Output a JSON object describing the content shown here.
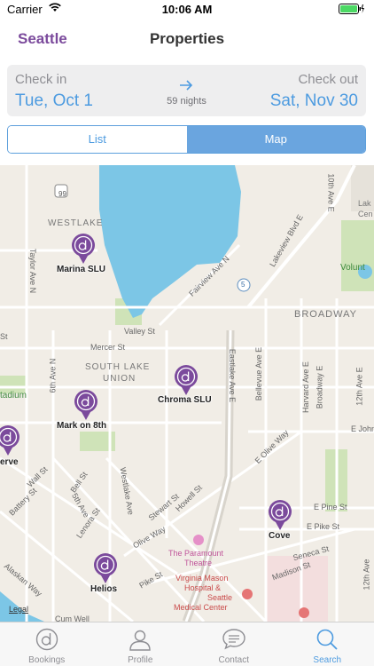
{
  "status": {
    "carrier": "Carrier",
    "time": "10:06 AM"
  },
  "nav": {
    "city": "Seattle",
    "title": "Properties"
  },
  "dates": {
    "checkin_label": "Check in",
    "checkin_value": "Tue, Oct 1",
    "nights": "59 nights",
    "checkout_label": "Check out",
    "checkout_value": "Sat, Nov 30"
  },
  "segment": {
    "list": "List",
    "map": "Map",
    "selected": "Map"
  },
  "map": {
    "pins": [
      {
        "name": "Marina SLU"
      },
      {
        "name": "Chroma SLU"
      },
      {
        "name": "Mark on 8th"
      },
      {
        "name": "erve"
      },
      {
        "name": "Cove"
      },
      {
        "name": "Helios"
      }
    ],
    "labels": {
      "westlake": "WESTLAKE",
      "south_lake_union": "SOUTH LAKE",
      "south_lake_union2": "UNION",
      "broadway": "BROADWAY",
      "lake": "Lak",
      "lake2": "Cen",
      "volunteer": "Volunt",
      "stadium": "tadium",
      "legal": "Legal",
      "paramount": "The Paramount",
      "paramount2": "Theatre",
      "vm1": "Virginia Mason",
      "vm2": "Hospital &",
      "vm3": "Seattle",
      "vm4": "Medical Center",
      "mercer": "Mercer St",
      "valley": "Valley St",
      "fairview": "Fairview Ave N",
      "eastlake": "Eastlake Ave E",
      "bellevue": "Bellevue Ave E",
      "harvard": "Harvard Ave E",
      "broadway_e": "Broadway E",
      "twelfth": "12th Ave E",
      "tenth": "10th Ave E",
      "lakeview": "Lakeview Blvd E",
      "taylor": "Taylor Ave N",
      "sixth": "6th Ave N",
      "westlake_ave": "Westlake Ave",
      "eolive": "E Olive Way",
      "epine": "E Pine St",
      "epike": "E Pike St",
      "ejohn": "E John",
      "seneca": "Seneca St",
      "madison": "Madison St",
      "pike": "Pike St",
      "olive": "Olive Way",
      "stewart": "Stewart St",
      "howell": "Howell St",
      "lenora": "Lenora St",
      "bell": "Bell St",
      "fifth": "5th Ave",
      "wall": "Wall St",
      "battery": "Battery St",
      "alaskan": "Alaskan Way",
      "st": "St",
      "twelfth_b": "12th Ave",
      "route99": "99",
      "route5": "5",
      "cum": "Cum Well"
    }
  },
  "tabs": [
    {
      "label": "Bookings",
      "icon": "bookings-logo-icon"
    },
    {
      "label": "Profile",
      "icon": "profile-icon"
    },
    {
      "label": "Contact",
      "icon": "chat-icon"
    },
    {
      "label": "Search",
      "icon": "search-icon"
    }
  ],
  "colors": {
    "brand": "#7b4a9c",
    "accent": "#4d9be0",
    "water": "#7cc6e6",
    "park": "#cfe3b8"
  }
}
